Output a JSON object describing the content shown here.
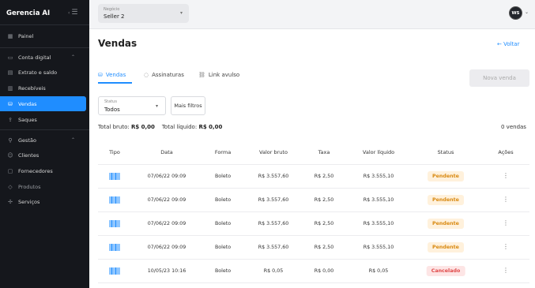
{
  "app": {
    "brand": "Gerencia AI"
  },
  "sidebar": {
    "items": [
      {
        "label": "Painel",
        "icon": "dashboard-icon"
      },
      {
        "label": "Conta digital",
        "icon": "wallet-icon",
        "section": true
      },
      {
        "label": "Extrato e saldo",
        "icon": "statement-icon"
      },
      {
        "label": "Recebíveis",
        "icon": "receivables-icon"
      },
      {
        "label": "Vendas",
        "icon": "sales-bag-icon",
        "active": true
      },
      {
        "label": "Saques",
        "icon": "withdraw-icon"
      },
      {
        "label": "Gestão",
        "icon": "management-icon",
        "section": true
      },
      {
        "label": "Clientes",
        "icon": "user-icon"
      },
      {
        "label": "Fornecedores",
        "icon": "supplier-icon"
      },
      {
        "label": "Produtos",
        "icon": "tag-icon"
      },
      {
        "label": "Serviços",
        "icon": "services-icon"
      }
    ]
  },
  "topbar": {
    "business_label": "Negócio",
    "business_value": "Seller 2",
    "avatar_initials": "WS"
  },
  "page": {
    "title": "Vendas",
    "back_label": "Voltar",
    "tabs": [
      {
        "label": "Vendas",
        "active": true
      },
      {
        "label": "Assinaturas",
        "active": false
      },
      {
        "label": "Link avulso",
        "active": false
      }
    ],
    "new_sale_label": "Nova venda",
    "status_filter_label": "Status",
    "status_filter_value": "Todos",
    "more_filters_label": "Mais filtros",
    "totals": {
      "gross_label": "Total bruto:",
      "gross_value": "R$ 0,00",
      "net_label": "Total líquido:",
      "net_value": "R$ 0,00",
      "count_text": "0 vendas"
    }
  },
  "table": {
    "columns": [
      "Tipo",
      "Data",
      "Forma",
      "Valor bruto",
      "Taxa",
      "Valor líquido",
      "Status",
      "Ações"
    ],
    "rows": [
      {
        "type": "barcode-icon",
        "date": "07/06/22 09:09",
        "method": "Boleto",
        "gross": "R$ 3.557,60",
        "fee": "R$ 2,50",
        "net": "R$ 3.555,10",
        "status": "Pendente",
        "status_kind": "pending"
      },
      {
        "type": "barcode-icon",
        "date": "07/06/22 09:09",
        "method": "Boleto",
        "gross": "R$ 3.557,60",
        "fee": "R$ 2,50",
        "net": "R$ 3.555,10",
        "status": "Pendente",
        "status_kind": "pending"
      },
      {
        "type": "barcode-icon",
        "date": "07/06/22 09:09",
        "method": "Boleto",
        "gross": "R$ 3.557,60",
        "fee": "R$ 2,50",
        "net": "R$ 3.555,10",
        "status": "Pendente",
        "status_kind": "pending"
      },
      {
        "type": "barcode-icon",
        "date": "07/06/22 09:09",
        "method": "Boleto",
        "gross": "R$ 3.557,60",
        "fee": "R$ 2,50",
        "net": "R$ 3.555,10",
        "status": "Pendente",
        "status_kind": "pending"
      },
      {
        "type": "barcode-icon",
        "date": "10/05/23 10:16",
        "method": "Boleto",
        "gross": "R$ 0,05",
        "fee": "R$ 0,00",
        "net": "R$ 0,05",
        "status": "Cancelado",
        "status_kind": "canceled"
      }
    ]
  },
  "colors": {
    "accent": "#1f8dff",
    "sidebar_bg": "#15171c",
    "pending_bg": "#fff1dc",
    "pending_text": "#d98a12",
    "canceled_bg": "#fde5e5",
    "canceled_text": "#e04848"
  }
}
